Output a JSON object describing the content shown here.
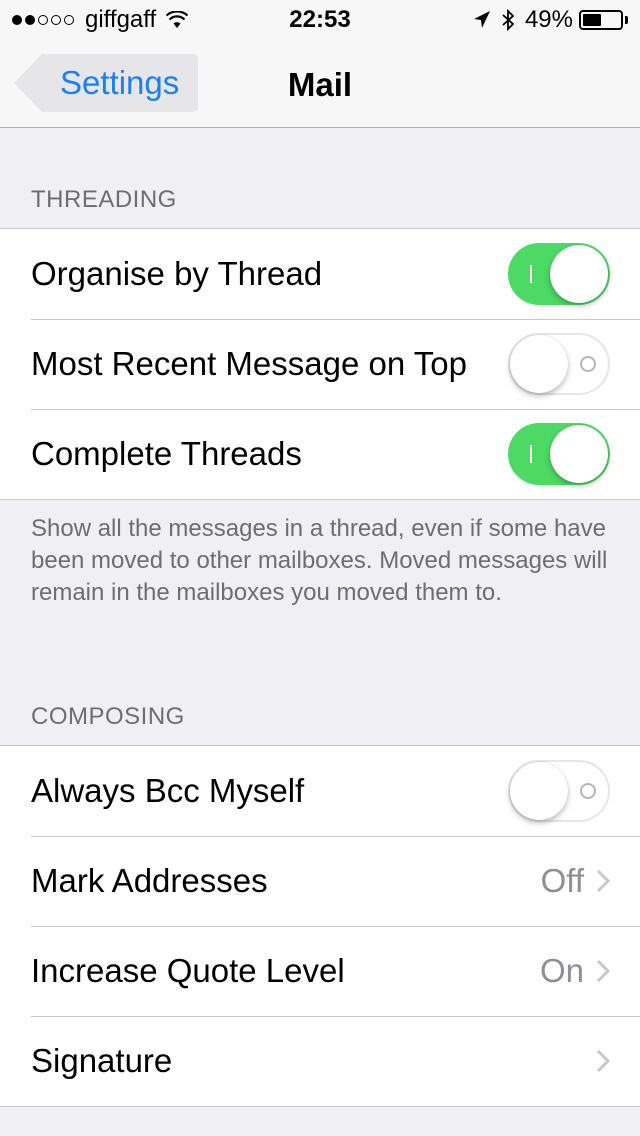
{
  "status_bar": {
    "carrier": "giffgaff",
    "time": "22:53",
    "battery_percent": "49%",
    "battery_level": 0.49,
    "signal_full": 2,
    "signal_total": 5
  },
  "nav": {
    "back_label": "Settings",
    "title": "Mail"
  },
  "threading": {
    "header": "THREADING",
    "rows": [
      {
        "label": "Organise by Thread",
        "on": true
      },
      {
        "label": "Most Recent Message on Top",
        "on": false
      },
      {
        "label": "Complete Threads",
        "on": true
      }
    ],
    "footer": "Show all the messages in a thread, even if some have been moved to other mailboxes. Moved messages will remain in the mailboxes you moved them to."
  },
  "composing": {
    "header": "COMPOSING",
    "rows": [
      {
        "label": "Always Bcc Myself",
        "on": false
      },
      {
        "label": "Mark Addresses",
        "value": "Off"
      },
      {
        "label": "Increase Quote Level",
        "value": "On"
      },
      {
        "label": "Signature",
        "value": ""
      }
    ]
  },
  "colors": {
    "accent": "#1e7ff2",
    "toggle_on": "#4cd964",
    "background": "#efeff4"
  }
}
